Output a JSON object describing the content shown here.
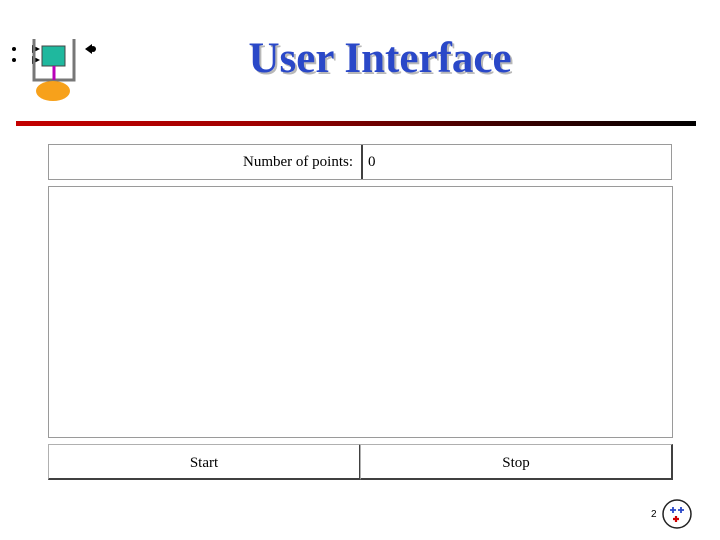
{
  "header": {
    "title": "User Interface"
  },
  "counter": {
    "label": "Number of points:",
    "value": "0"
  },
  "buttons": {
    "start_label": "Start",
    "stop_label": "Stop"
  },
  "footer": {
    "page_number": "2"
  },
  "colors": {
    "title": "#2a48c8",
    "rule_start": "#c40000",
    "rule_end": "#000000"
  },
  "icons": {
    "top_left": "system-diagram-icon",
    "bottom_right": "university-seal-icon"
  }
}
